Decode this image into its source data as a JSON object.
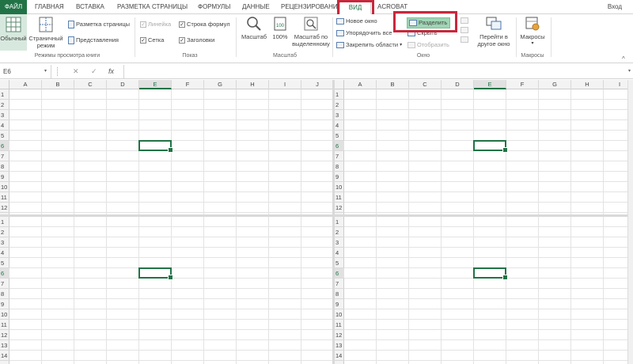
{
  "tabs": {
    "file": "ФАЙЛ",
    "home": "ГЛАВНАЯ",
    "insert": "ВСТАВКА",
    "page_layout": "РАЗМЕТКА СТРАНИЦЫ",
    "formulas": "ФОРМУЛЫ",
    "data": "ДАННЫЕ",
    "review": "РЕЦЕНЗИРОВАНИЕ",
    "view": "ВИД",
    "acrobat": "ACROBAT"
  },
  "login": "Вход",
  "ribbon": {
    "views": {
      "normal": "Обычный",
      "page_mode": "Страничный режим",
      "page_layout": "Разметка страницы",
      "custom": "Представления",
      "label": "Режимы просмотра книги"
    },
    "show": {
      "ruler": "Линейка",
      "formula_bar": "Строка формул",
      "grid": "Сетка",
      "headings": "Заголовки",
      "label": "Показ"
    },
    "zoom": {
      "zoom": "Масштаб",
      "hundred": "100%",
      "selection": "Масштаб по выделенному",
      "label": "Масштаб"
    },
    "window": {
      "new_window": "Новое окно",
      "arrange_all": "Упорядочить все",
      "freeze": "Закрепить области",
      "split": "Разделить",
      "hide": "Скрыть",
      "unhide": "Отобразить",
      "switch": "Перейти в другое окно",
      "label": "Окно"
    },
    "macros": {
      "macros": "Макросы",
      "label": "Макросы"
    }
  },
  "formula_bar": {
    "name_box": "E6",
    "cancel": "✕",
    "enter": "✓",
    "fx": "fx",
    "value": ""
  },
  "sheet": {
    "columns": [
      "A",
      "B",
      "C",
      "D",
      "E",
      "F",
      "G",
      "H",
      "I",
      "J"
    ],
    "rows_top": [
      "1",
      "2",
      "3",
      "4",
      "5",
      "6",
      "7",
      "8",
      "9",
      "10",
      "11",
      "12"
    ],
    "rows_bottom": [
      "1",
      "2",
      "3",
      "4",
      "5",
      "6",
      "7",
      "8",
      "9",
      "10",
      "11",
      "12",
      "13",
      "14"
    ],
    "active_cell": "E6"
  },
  "colors": {
    "excel_green": "#217346",
    "highlight_red": "#c8283c"
  }
}
